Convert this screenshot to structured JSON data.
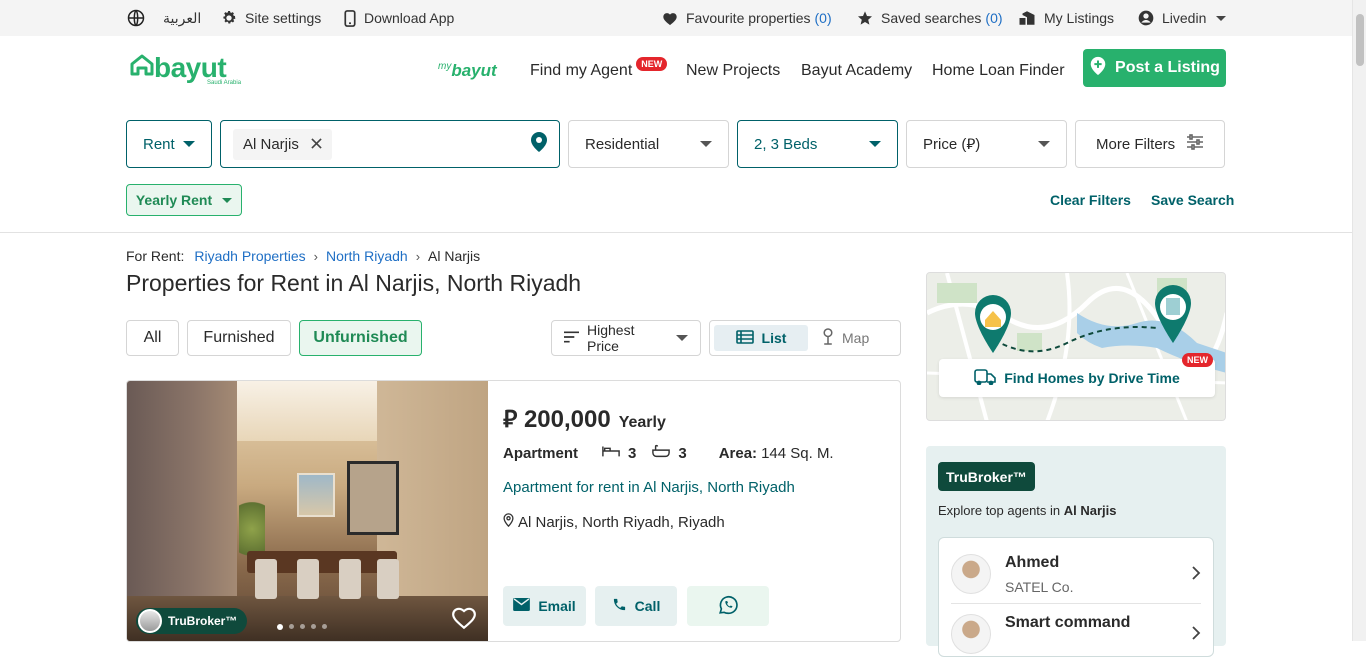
{
  "topbar": {
    "language": "العربية",
    "site_settings": "Site settings",
    "download_app": "Download App",
    "favourite_label": "Favourite properties",
    "favourite_count": "(0)",
    "saved_label": "Saved searches",
    "saved_count": "(0)",
    "my_listings": "My Listings",
    "user": "Livedin"
  },
  "header": {
    "logo": "bayut",
    "logo_sub": "Saudi Arabia",
    "mybayut_my": "my",
    "mybayut_brand": "bayut",
    "nav": [
      "Find my Agent",
      "New Projects",
      "Bayut Academy",
      "Home Loan Finder"
    ],
    "new_badge": "NEW",
    "post_listing": "Post a Listing"
  },
  "filters": {
    "purpose": "Rent",
    "location_chip": "Al Narjis",
    "category": "Residential",
    "beds": "2, 3 Beds",
    "price": "Price (⃁)",
    "more": "More Filters",
    "rent_frequency": "Yearly Rent",
    "clear": "Clear Filters",
    "save": "Save Search"
  },
  "breadcrumb": {
    "prefix": "For Rent:",
    "items": [
      "Riyadh Properties",
      "North Riyadh",
      "Al Narjis"
    ]
  },
  "page_title": "Properties for Rent in Al Narjis, North Riyadh",
  "furnishing_tabs": [
    "All",
    "Furnished",
    "Unfurnished"
  ],
  "sort": "Highest Price",
  "view": {
    "list": "List",
    "map": "Map"
  },
  "listing": {
    "currency": "⃁",
    "price": "200,000",
    "period": "Yearly",
    "type": "Apartment",
    "beds": "3",
    "baths": "3",
    "area_label": "Area:",
    "area_value": "144 Sq. M.",
    "title": "Apartment for rent in Al Narjis, North Riyadh",
    "location": "Al Narjis, North Riyadh, Riyadh",
    "trubroker_badge": "TruBroker™",
    "email": "Email",
    "call": "Call",
    "photo_dots": 5,
    "active_dot": 0
  },
  "map_widget": {
    "label": "Find Homes by Drive Time",
    "badge": "NEW"
  },
  "trubroker": {
    "logo": "TruBroker™",
    "explore_prefix": "Explore top agents in",
    "explore_area": "Al Narjis",
    "agents": [
      {
        "name": "Ahmed",
        "company": "SATEL Co."
      },
      {
        "name": "Smart command",
        "company": ""
      }
    ]
  },
  "colors": {
    "brand_green": "#28b16d",
    "teal": "#006169",
    "new_red": "#e4262c",
    "link_blue": "#1f6fc5"
  }
}
